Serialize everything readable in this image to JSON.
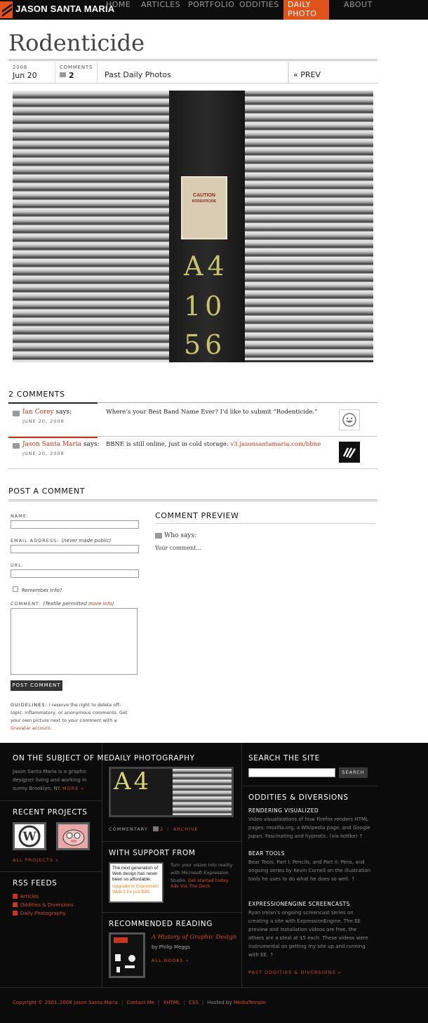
{
  "site": {
    "name": "JASON SANTA MARIA"
  },
  "nav": [
    {
      "label": "HOME"
    },
    {
      "label": "ARTICLES"
    },
    {
      "label": "PORTFOLIO"
    },
    {
      "label": "ODDITIES"
    },
    {
      "label": "DAILY PHOTO"
    },
    {
      "label": "ABOUT"
    }
  ],
  "post": {
    "title": "Rodenticide",
    "year": "2008",
    "date": "Jun 20",
    "comments_label": "COMMENTS",
    "comments_count": "2",
    "past_link": "Past Daily Photos",
    "prev_link": "« PREV",
    "photo": {
      "sign": "CAUTION",
      "sign_sub": "RODENTICIDE",
      "chalk": [
        "A4",
        "10",
        "56"
      ]
    }
  },
  "comments": {
    "heading": "2 COMMENTS",
    "items": [
      {
        "author": "Ian Corey",
        "says": "says:",
        "date": "JUNE 20, 2008",
        "body": "Where’s your Best Band Name Ever? I’d like to submit “Rodenticide.”",
        "link": ""
      },
      {
        "author": "Jason Santa Maria",
        "says": "says:",
        "date": "JUNE 20, 2008",
        "body": "BBNE is still online, just in cold storage: ",
        "link": "v3.jasonsantamaria.com/bbne"
      }
    ]
  },
  "form": {
    "heading": "POST A COMMENT",
    "name_label": "NAME:",
    "email_label": "EMAIL ADDRESS:",
    "email_note": "(never made public)",
    "url_label": "URL:",
    "remember_label": "Remember Info?",
    "comment_label": "COMMENT:",
    "textile_note": "(Textile permitted ",
    "more_info": "more info",
    "textile_close": ")",
    "submit": "POST COMMENT",
    "guidelines_label": "GUIDELINES:",
    "guidelines_text": " I reserve the right to delete off-topic, inflammatory, or anonymous comments. Get your own picture next to your comment with a ",
    "gravatar": "Gravatar account",
    "guidelines_end": "."
  },
  "preview": {
    "heading": "COMMENT PREVIEW",
    "who": "Who says:",
    "body": "Your comment..."
  },
  "footer": {
    "subject": {
      "title": "ON THE SUBJECT OF ME",
      "text": "Jason Santa Maria is a graphic designer living and working in sunny Brooklyn, NY.",
      "more": "MORE »"
    },
    "projects": {
      "title": "RECENT PROJECTS",
      "all": "ALL PROJECTS »"
    },
    "rss": {
      "title": "RSS FEEDS",
      "items": [
        "Articles",
        "Oddities & Diversions",
        "Daily Photography"
      ]
    },
    "daily": {
      "title": "DAILY PHOTOGRAPHY",
      "commentary": "COMMENTARY",
      "count": "2",
      "archive": "ARCHIVE"
    },
    "support": {
      "title": "WITH SUPPORT FROM",
      "ad_line1": "The next generation of",
      "ad_line2": "Web design has never",
      "ad_line3": "been so affordable.",
      "ad_offer": "Upgrade to Expression Web 2 for just $99.",
      "text": "Turn your vision into reality with Microsoft Expression Studio.",
      "cta": "Get started today.",
      "via": "Ads Via The Deck"
    },
    "reading": {
      "title": "RECOMMENDED READING",
      "book": "A History of Graphic Design",
      "author": "by Philip Meggs",
      "all": "ALL BOOKS »"
    },
    "search": {
      "title": "SEARCH THE SITE",
      "button": "SEARCH"
    },
    "oddities": {
      "title": "ODDITIES & DIVERSIONS",
      "items": [
        {
          "title": "RENDERING VISUALIZED",
          "body": "Video visualizations of how Firefox renders HTML pages: mozilla.org, a Wikipedia page, and Google Japan. Fascinating and hypnotic. (via kottke) ↑"
        },
        {
          "title": "BEAR TOOLS",
          "body": "Bear Tools, Part I: Pencils, and Part II: Pens, and ongoing series by Kevin Cornell on the illustration tools he uses to do what he does so well. ↑"
        },
        {
          "title": "EXPRESSIONENGINE SCREENCASTS",
          "body": "Ryan Irelan’s ongoing screencast series on creating a site with ExpressionEngine. The EE preview and installation videos are free, the others are a steal at $5 each. These videos were instrumental on getting my site up and running with EE. ↑"
        }
      ],
      "past": "PAST ODDITIES & DIVERSIONS »"
    },
    "copyright": {
      "text": "Copyright © 2001–2008 Jason Santa Maria",
      "links": [
        "Contact Me",
        "XHTML",
        "CSS"
      ],
      "hosted": "Hosted by",
      "host": "MediaTemple"
    }
  }
}
